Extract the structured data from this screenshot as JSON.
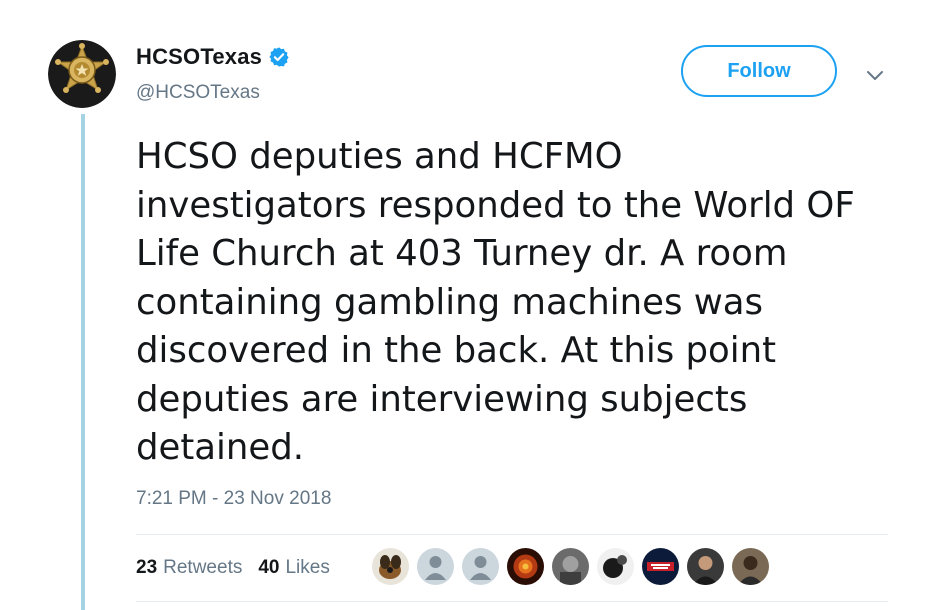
{
  "tweet": {
    "display_name": "HCSOTexas",
    "handle": "@HCSOTexas",
    "verified": true,
    "follow_label": "Follow",
    "text_lines": [
      "HCSO deputies and HCFMO",
      "investigators responded to the World OF",
      "Life Church at 403 Turney dr. A room",
      "containing gambling machines was",
      "discovered in the back. At this point",
      "deputies are interviewing subjects",
      "detained."
    ],
    "timestamp": "7:21 PM - 23 Nov 2018",
    "retweets_count": "23",
    "retweets_label": "Retweets",
    "likes_count": "40",
    "likes_label": "Likes"
  },
  "colors": {
    "accent": "#1da1f2",
    "thread_line": "#a4d4e4",
    "secondary_text": "#657786"
  },
  "icons": {
    "verified": "verified-badge-icon",
    "menu": "chevron-down-icon",
    "avatar": "sheriff-star-badge"
  },
  "likers": [
    {
      "style": "dog"
    },
    {
      "style": "default"
    },
    {
      "style": "default"
    },
    {
      "style": "fire"
    },
    {
      "style": "gray"
    },
    {
      "style": "dark"
    },
    {
      "style": "logo"
    },
    {
      "style": "person"
    },
    {
      "style": "person2"
    }
  ]
}
